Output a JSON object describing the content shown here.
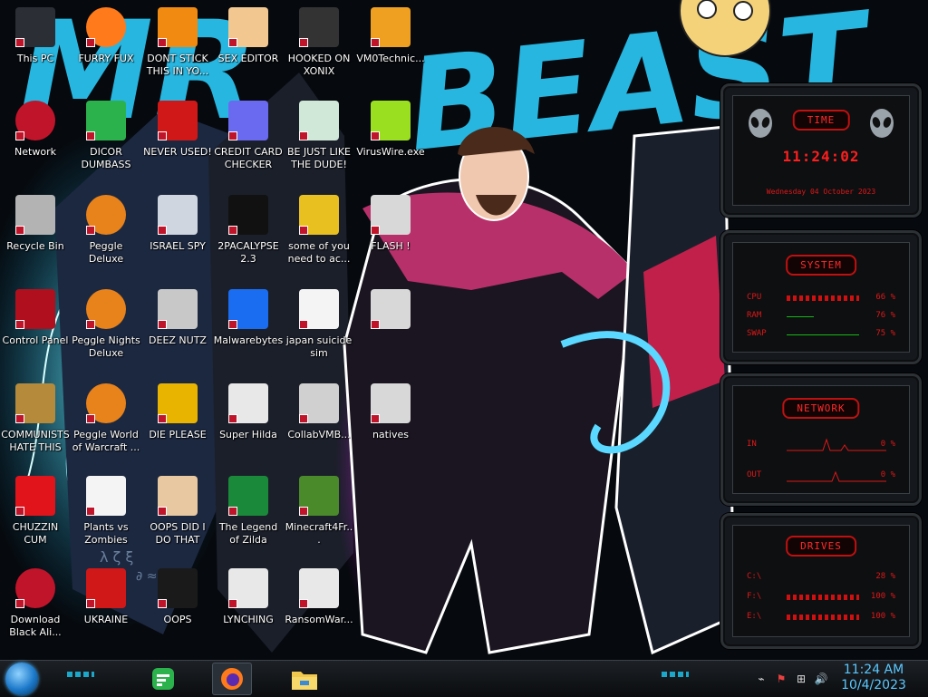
{
  "wallpaper": {
    "headline": "MR BEAST"
  },
  "desktop_icons": [
    {
      "id": "this-pc",
      "label": "This PC",
      "icon": "pc-icon",
      "color": "#2b2f35"
    },
    {
      "id": "network",
      "label": "Network",
      "icon": "network-icon",
      "color": "#c0142a"
    },
    {
      "id": "recycle-bin",
      "label": "Recycle Bin",
      "icon": "recycle-bin-icon",
      "color": "#b3b3b3"
    },
    {
      "id": "control-panel",
      "label": "Control Panel",
      "icon": "control-panel-icon",
      "color": "#b0101e"
    },
    {
      "id": "communists",
      "label": "COMMUNISTS HATE THIS G...",
      "icon": "money-bag-icon",
      "color": "#b58a3a"
    },
    {
      "id": "chuzzin",
      "label": "CHUZZIN CUM",
      "icon": "chuzzle-icon",
      "color": "#e0141a"
    },
    {
      "id": "download-black",
      "label": "Download Black Ali...",
      "icon": "alien-icon",
      "color": "#c0142a"
    },
    {
      "id": "furry-fux",
      "label": "FURRY FUX",
      "icon": "firefox-icon",
      "color": "#ff7a1a"
    },
    {
      "id": "dicor",
      "label": "DICOR DUMBASS",
      "icon": "feedly-icon",
      "color": "#2bb24c"
    },
    {
      "id": "peggle-deluxe",
      "label": "Peggle Deluxe",
      "icon": "peggle-icon",
      "color": "#e8821a"
    },
    {
      "id": "peggle-nights",
      "label": "Peggle Nights Deluxe",
      "icon": "peggle-icon",
      "color": "#e8821a"
    },
    {
      "id": "peggle-world",
      "label": "Peggle World of Warcraft ...",
      "icon": "peggle-icon",
      "color": "#e8821a"
    },
    {
      "id": "plants-zombies",
      "label": "Plants vs Zombies",
      "icon": "flower-icon",
      "color": "#f4f4f4"
    },
    {
      "id": "ukraine",
      "label": "UKRAINE",
      "icon": "radiation-icon",
      "color": "#d01818"
    },
    {
      "id": "dont-stick",
      "label": "DONT STICK THIS IN YO...",
      "icon": "vlc-icon",
      "color": "#f08a10"
    },
    {
      "id": "never-used",
      "label": "NEVER USED!",
      "icon": "devcpp-icon",
      "color": "#d01818"
    },
    {
      "id": "israel-spy",
      "label": "ISRAEL SPY",
      "icon": "network-card-icon",
      "color": "#cfd6e0"
    },
    {
      "id": "deez-nutz",
      "label": "DEEZ NUTZ",
      "icon": "windows-stack-icon",
      "color": "#c8c8c8"
    },
    {
      "id": "die-please",
      "label": "DIE PLEASE",
      "icon": "de-icon",
      "color": "#e8b400"
    },
    {
      "id": "oops-did",
      "label": "OOPS DID I DO THAT",
      "icon": "portrait-icon",
      "color": "#e8c8a0"
    },
    {
      "id": "oops",
      "label": "OOPS",
      "icon": "monitor-icon",
      "color": "#1a1a1a"
    },
    {
      "id": "sex-editor",
      "label": "SEX EDITOR",
      "icon": "hxd-icon",
      "color": "#f2c890"
    },
    {
      "id": "credit-card",
      "label": "CREDIT CARD CHECKER",
      "icon": "credit-card-icon",
      "color": "#6a6af0"
    },
    {
      "id": "2pacalypse",
      "label": "2PACALYPSE 2.3",
      "icon": "terminal-icon",
      "color": "#111111"
    },
    {
      "id": "malwarebytes",
      "label": "Malwarebytes",
      "icon": "malwarebytes-icon",
      "color": "#1a6cf0"
    },
    {
      "id": "super-hilda",
      "label": "Super Hilda",
      "icon": "pixel-icon",
      "color": "#e8e8e8"
    },
    {
      "id": "legend-zilda",
      "label": "The Legend of Zilda",
      "icon": "pixel-hero-icon",
      "color": "#1a8a3a"
    },
    {
      "id": "lynching",
      "label": "LYNCHING",
      "icon": "knot-icon",
      "color": "#e8e8e8"
    },
    {
      "id": "hooked-xonix",
      "label": "HOOKED ON XONIX",
      "icon": "xonix-icon",
      "color": "#333333"
    },
    {
      "id": "be-just-like",
      "label": "BE JUST LIKE THE DUDE!",
      "icon": "santa-icon",
      "color": "#cfe8d8"
    },
    {
      "id": "some-of-you",
      "label": "some of you need to ac...",
      "icon": "dog-icon",
      "color": "#e8c020"
    },
    {
      "id": "japan-suicide",
      "label": "japan suicide sim",
      "icon": "document-icon",
      "color": "#f4f4f4"
    },
    {
      "id": "collabvmb",
      "label": "CollabVMB...",
      "icon": "vm-icon",
      "color": "#d0d0d0"
    },
    {
      "id": "minecraft",
      "label": "Minecraft4Fr...",
      "icon": "grass-block-icon",
      "color": "#4a8a2a"
    },
    {
      "id": "ransomware",
      "label": "RansomWar...",
      "icon": "skull-icon",
      "color": "#e8e8e8"
    },
    {
      "id": "vm0technic",
      "label": "VM0Technic...",
      "icon": "doctor-icon",
      "color": "#f0a020"
    },
    {
      "id": "viruswire",
      "label": "VirusWire.exe",
      "icon": "lime-icon",
      "color": "#9ae020"
    },
    {
      "id": "flash",
      "label": "FLASH !",
      "icon": "generic-file-icon",
      "color": "#d8d8d8"
    },
    {
      "id": "blank",
      "label": "",
      "icon": "generic-file-icon",
      "color": "#d8d8d8"
    },
    {
      "id": "natives",
      "label": "natives",
      "icon": "generic-file-icon",
      "color": "#d8d8d8"
    }
  ],
  "gadget": {
    "time": {
      "title": "TIME",
      "clock": "11:24:02",
      "date": "Wednesday 04 October 2023"
    },
    "system": {
      "title": "SYSTEM",
      "rows": [
        {
          "label": "CPU",
          "value": "66 %"
        },
        {
          "label": "RAM",
          "value": "76 %"
        },
        {
          "label": "SWAP",
          "value": "75 %"
        }
      ]
    },
    "network": {
      "title": "NETWORK",
      "rows": [
        {
          "label": "IN",
          "value": "0 %"
        },
        {
          "label": "OUT",
          "value": "0 %"
        }
      ]
    },
    "drives": {
      "title": "DRIVES",
      "rows": [
        {
          "label": "C:\\",
          "value": "28 %"
        },
        {
          "label": "F:\\",
          "value": "100 %"
        },
        {
          "label": "E:\\",
          "value": "100 %"
        }
      ]
    },
    "accent": "#e01818"
  },
  "taskbar": {
    "pinned": [
      {
        "name": "feedly-app",
        "icon": "feedly-icon",
        "color": "#2bb24c"
      },
      {
        "name": "firefox-app",
        "icon": "firefox-icon",
        "color": "#ff7a1a"
      },
      {
        "name": "explorer-app",
        "icon": "folder-icon",
        "color": "#f2c94c"
      }
    ],
    "tray": [
      "cursor-icon",
      "flag-icon",
      "network-status-icon",
      "volume-icon"
    ],
    "clock": {
      "time": "11:24 AM",
      "date": "10/4/2023"
    }
  }
}
